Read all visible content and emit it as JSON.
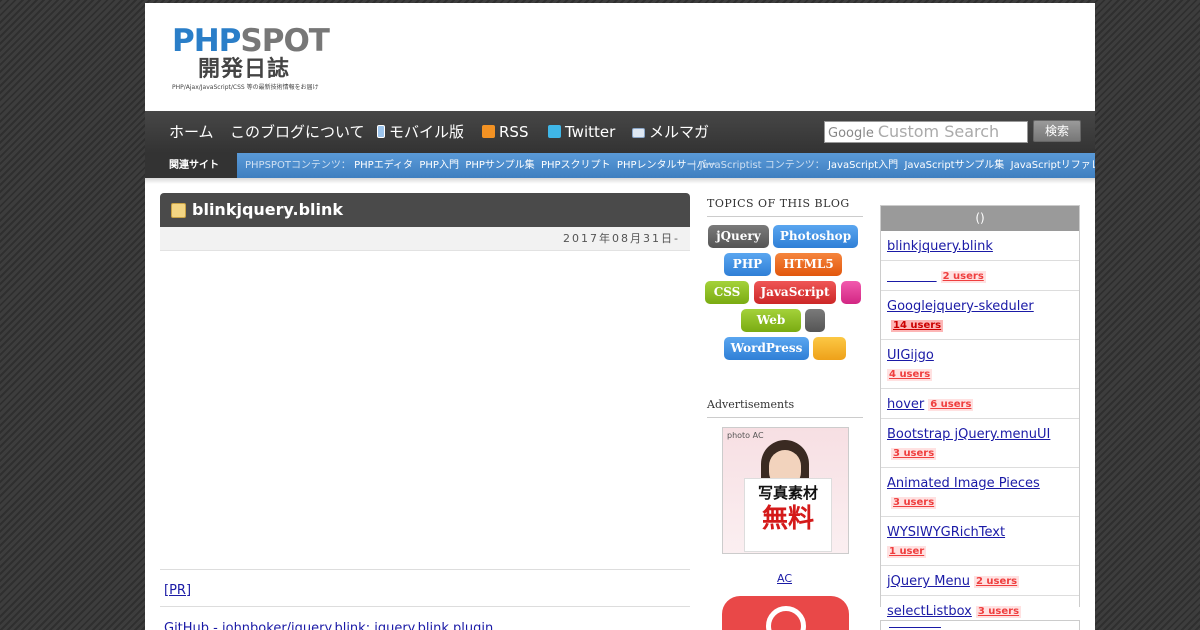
{
  "logo": {
    "main_a": "PHP",
    "main_b": "SPOT",
    "jp": "開発日誌",
    "sub": "PHP/Ajax/JavaScript/CSS 等の最新技術情報をお届け"
  },
  "nav": {
    "items": [
      {
        "label": "ホーム",
        "icon": "none"
      },
      {
        "label": "このブログについて",
        "icon": "none"
      },
      {
        "label": "モバイル版",
        "icon": "mobile-icon"
      },
      {
        "label": "RSS",
        "icon": "rss-icon"
      },
      {
        "label": "Twitter",
        "icon": "twitter-icon"
      },
      {
        "label": "メルマガ",
        "icon": "mail-icon"
      }
    ],
    "search_google": "Google",
    "search_placeholder": "Custom Search",
    "search_button": "検索"
  },
  "related": {
    "label": "関連サイト",
    "phpspot_prefix": "PHPSPOTコンテンツ：",
    "phpspot_links": [
      "PHPエディタ",
      "PHP入門",
      "PHPサンプル集",
      "PHPスクリプト",
      "PHPレンタルサーバー"
    ],
    "js_prefix": "JavaScriptist コンテンツ：",
    "js_links": [
      "JavaScript入門",
      "JavaScriptサンプル集",
      "JavaScriptリファレンス"
    ]
  },
  "post": {
    "title": "blinkjquery.blink",
    "date": "2017年08月31日-",
    "pr_link": "[PR]",
    "github_link": "GitHub - johnboker/jquery.blink: jquery.blink plugin"
  },
  "topics": {
    "heading": "TOPICS OF THIS BLOG",
    "tags": [
      "jQuery",
      "Photoshop",
      "PHP",
      "HTML5",
      "CSS",
      "JavaScript",
      "",
      "Web",
      "",
      "WordPress",
      ""
    ],
    "colors": {
      "gray": "#666666",
      "blue": "#3b8fe0",
      "orange": "#f06a1e",
      "green": "#8cbf1e",
      "red": "#e23a3a",
      "pink": "#e83a9a",
      "yellow": "#f5b624"
    }
  },
  "ads": {
    "heading": "Advertisements",
    "photo_tag": "photo AC",
    "line1": "写真素材",
    "line2": "無料",
    "link": "AC"
  },
  "ranking": {
    "heading": "()",
    "items": [
      {
        "title": "blinkjquery.blink",
        "users": ""
      },
      {
        "title": "",
        "users": "2 users"
      },
      {
        "title": "Googlejquery-skeduler",
        "users": "14 users"
      },
      {
        "title": "UIGijgo",
        "users": "4 users"
      },
      {
        "title": "hover",
        "users": "6 users"
      },
      {
        "title": "Bootstrap jQuery.menuUI",
        "users": "3 users"
      },
      {
        "title": "Animated Image Pieces",
        "users": "3 users"
      },
      {
        "title": "WYSIWYGRichText",
        "users": "1 user"
      },
      {
        "title": "jQuery Menu",
        "users": "2 users"
      },
      {
        "title": "selectListbox",
        "users": "3 users"
      }
    ]
  }
}
